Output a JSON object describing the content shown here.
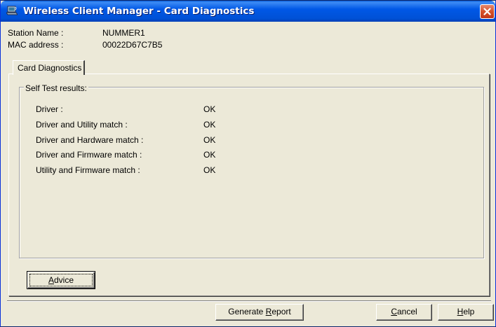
{
  "window": {
    "title": "Wireless Client Manager - Card Diagnostics",
    "icon": "laptop-wireless-icon"
  },
  "station": {
    "name_label": "Station Name :",
    "name_value": "NUMMER1",
    "mac_label": "MAC address :",
    "mac_value": "00022D67C7B5"
  },
  "tabs": [
    {
      "label": "Card Diagnostics",
      "active": true
    }
  ],
  "self_test": {
    "title": "Self Test results:",
    "rows": [
      {
        "label": "Driver :",
        "value": "OK"
      },
      {
        "label": "Driver and Utility match :",
        "value": "OK"
      },
      {
        "label": "Driver and Hardware match :",
        "value": "OK"
      },
      {
        "label": "Driver and Firmware match :",
        "value": "OK"
      },
      {
        "label": "Utility and Firmware match :",
        "value": "OK"
      }
    ]
  },
  "buttons": {
    "advice": {
      "pre": "",
      "mnemonic": "A",
      "post": "dvice"
    },
    "generate_report": {
      "pre": "Generate ",
      "mnemonic": "R",
      "post": "eport"
    },
    "cancel": {
      "pre": "",
      "mnemonic": "C",
      "post": "ancel"
    },
    "help": {
      "pre": "",
      "mnemonic": "H",
      "post": "elp"
    }
  },
  "colors": {
    "titlebar": "#0058e6",
    "face": "#ece9d8",
    "close": "#d5512a"
  }
}
